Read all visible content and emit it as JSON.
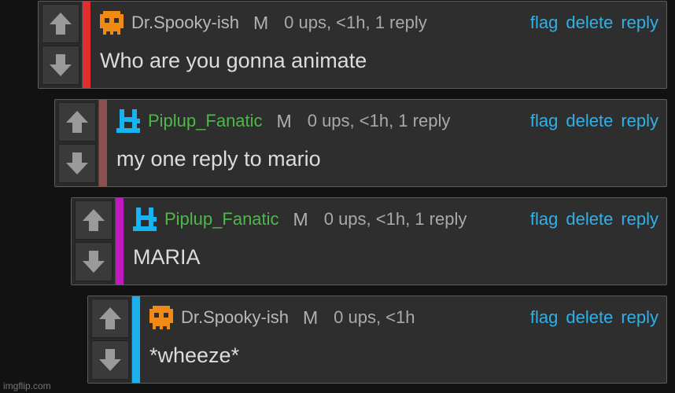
{
  "comments": [
    {
      "username": "Dr.Spooky-ish",
      "mod_badge": "M",
      "meta": "0 ups, <1h, 1 reply",
      "body": "Who are you gonna animate",
      "bar_color": "#e02d2d",
      "avatar": "orange-skull-icon",
      "actions": {
        "flag": "flag",
        "delete": "delete",
        "reply": "reply"
      }
    },
    {
      "username": "Piplup_Fanatic",
      "mod_badge": "M",
      "meta": "0 ups, <1h, 1 reply",
      "body": "my one reply to mario",
      "bar_color": "#8e4f4f",
      "avatar": "blue-pixel-icon",
      "actions": {
        "flag": "flag",
        "delete": "delete",
        "reply": "reply"
      }
    },
    {
      "username": "Piplup_Fanatic",
      "mod_badge": "M",
      "meta": "0 ups, <1h, 1 reply",
      "body": "MARIA",
      "bar_color": "#c118c1",
      "avatar": "blue-pixel-icon",
      "actions": {
        "flag": "flag",
        "delete": "delete",
        "reply": "reply"
      }
    },
    {
      "username": "Dr.Spooky-ish",
      "mod_badge": "M",
      "meta": "0 ups, <1h",
      "body": "*wheeze*",
      "bar_color": "#1ab0ec",
      "avatar": "orange-skull-icon",
      "actions": {
        "flag": "flag",
        "delete": "delete",
        "reply": "reply"
      }
    }
  ],
  "watermark": "imgflip.com",
  "colors": {
    "link": "#2fb1e8",
    "green_user": "#4db848",
    "background": "#121212"
  }
}
